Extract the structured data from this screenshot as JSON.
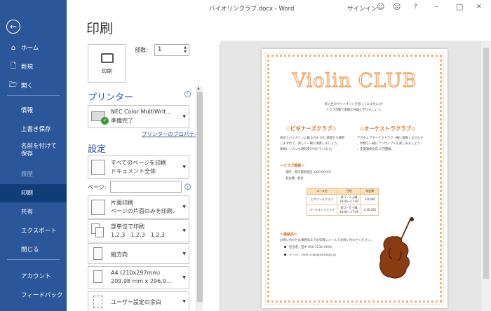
{
  "window": {
    "doc_title": "バイオリンクラブ.docx",
    "app": "Word",
    "separator": " - ",
    "signin": "サインイン",
    "smile_icon": "smile-icon",
    "frown_icon": "frown-icon",
    "help": "?",
    "minimize": "─",
    "maximize": "□",
    "close": "✕"
  },
  "nav": {
    "back_icon": "back-arrow-icon",
    "items": [
      {
        "label": "ホーム",
        "icon": "home-icon",
        "glyph": "⌂"
      },
      {
        "label": "新規",
        "icon": "new-document-icon",
        "glyph": "🗋"
      },
      {
        "label": "開く",
        "icon": "open-folder-icon",
        "glyph": "🗁"
      },
      {
        "label": "情報"
      },
      {
        "label": "上書き保存"
      },
      {
        "label": "名前を付けて保存"
      },
      {
        "label": "履歴",
        "disabled": true
      },
      {
        "label": "印刷",
        "selected": true
      },
      {
        "label": "共有"
      },
      {
        "label": "エクスポート"
      },
      {
        "label": "閉じる"
      },
      {
        "label": "アカウント"
      },
      {
        "label": "フィードバック"
      }
    ]
  },
  "print": {
    "title": "印刷",
    "button_label": "印刷",
    "copies_label": "部数:",
    "copies_value": "1"
  },
  "printer": {
    "section_title": "プリンター",
    "name": "NEC Color MultiWrit…",
    "status": "準備完了",
    "properties_link": "プリンターのプロパティ"
  },
  "settings": {
    "section_title": "設定",
    "range_l1": "すべてのページを印刷",
    "range_l2": "ドキュメント全体",
    "pages_label": "ページ:",
    "pages_value": "",
    "sides_l1": "片面印刷",
    "sides_l2": "ページの片面のみを印刷…",
    "collate_l1": "部単位で印刷",
    "collate_l2": "1,2,3　1,2,3　1,2,3",
    "orientation": "縦方向",
    "paper_l1": "A4 (210x297mm)",
    "paper_l2": "209.98 mm x 296.9…",
    "margins": "ユーザー設定の余白"
  },
  "doc": {
    "heading": "Violin CLUB",
    "intro_1": "新入生のヴァイオリンを習ってみませんか？",
    "intro_2": "クラブ活動で素敵な仲間と学びましょう。",
    "club1": "◇ビギナーズクラブ◇",
    "club2": "◇オーケストラクラブ◇",
    "club1_text_1": "初めてバイオリンに触る方も OK! 基礎から練習",
    "club1_text_2": "しますので、楽しく一緒に演奏しましょう。",
    "club1_text_3": "体験レッスンも随時受け付けています。",
    "club2_text_1": "アマチュアオーケストラで一緒に演奏しませんか",
    "club2_text_2": "。仲間と一緒にアンサンブルを楽しみましょう",
    "club2_text_3": "。定期演奏会年 2 回開催。",
    "info_header": "～クラブ情報～",
    "info_1": "場所：東京都新宿区 XXX-XXXXX",
    "info_2": "参加費：無料",
    "table_headers": [
      "コース名",
      "日程",
      "年会費"
    ],
    "table_rows": [
      [
        "ビギナーズクラブ",
        "第 1・3 土曜",
        "18:00～17:00",
        "￥8,000"
      ],
      [
        "オーケストラクラブ",
        "第 2・4 土曜",
        "18:00～17:00",
        "￥10,000"
      ]
    ],
    "contact_header": "～連絡先～",
    "contact_intro": "お問い合わせは事務局までお気軽にメールでお問い合わせください。",
    "contact_1": "担当者：田中 090-1234-XXXX",
    "contact_2": "メール：violin.club@example.jp"
  }
}
